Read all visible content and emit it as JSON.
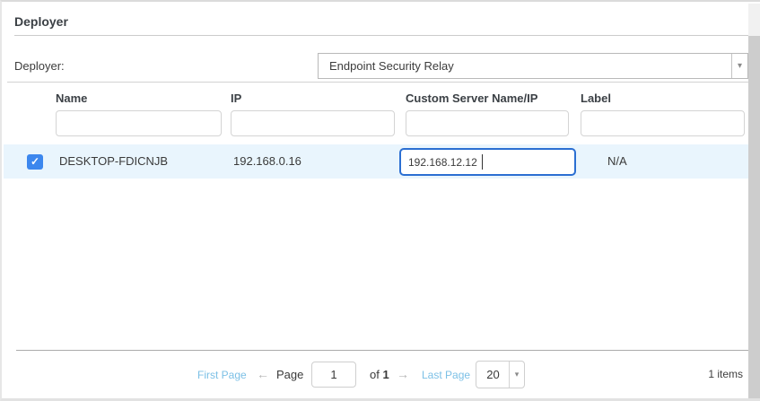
{
  "panel": {
    "title": "Deployer"
  },
  "form": {
    "label": "Deployer:",
    "select_value": "Endpoint Security Relay"
  },
  "icons": {
    "chevron_down": "▾",
    "checkmark": "✓",
    "arrow_left": "←",
    "arrow_right": "→"
  },
  "table": {
    "columns": [
      {
        "label": "Name",
        "filter_value": ""
      },
      {
        "label": "IP",
        "filter_value": ""
      },
      {
        "label": "Custom Server Name/IP",
        "filter_value": ""
      },
      {
        "label": "Label",
        "filter_value": ""
      }
    ],
    "rows": [
      {
        "selected": true,
        "name": "DESKTOP-FDICNJB",
        "ip": "192.168.0.16",
        "custom_server_value": "192.168.12.12",
        "label": "N/A"
      }
    ]
  },
  "pagination": {
    "first_page": "First Page",
    "page": "Page",
    "current_page": "1",
    "of": "of",
    "total_pages": "1",
    "last_page": "Last Page",
    "page_size": "20",
    "items": "1 items"
  },
  "colors": {
    "accent_blue": "#3c87ee",
    "focus_border": "#2b6fd2",
    "selected_row_bg": "#e9f5fd",
    "link_blue": "#7cc0e6"
  }
}
